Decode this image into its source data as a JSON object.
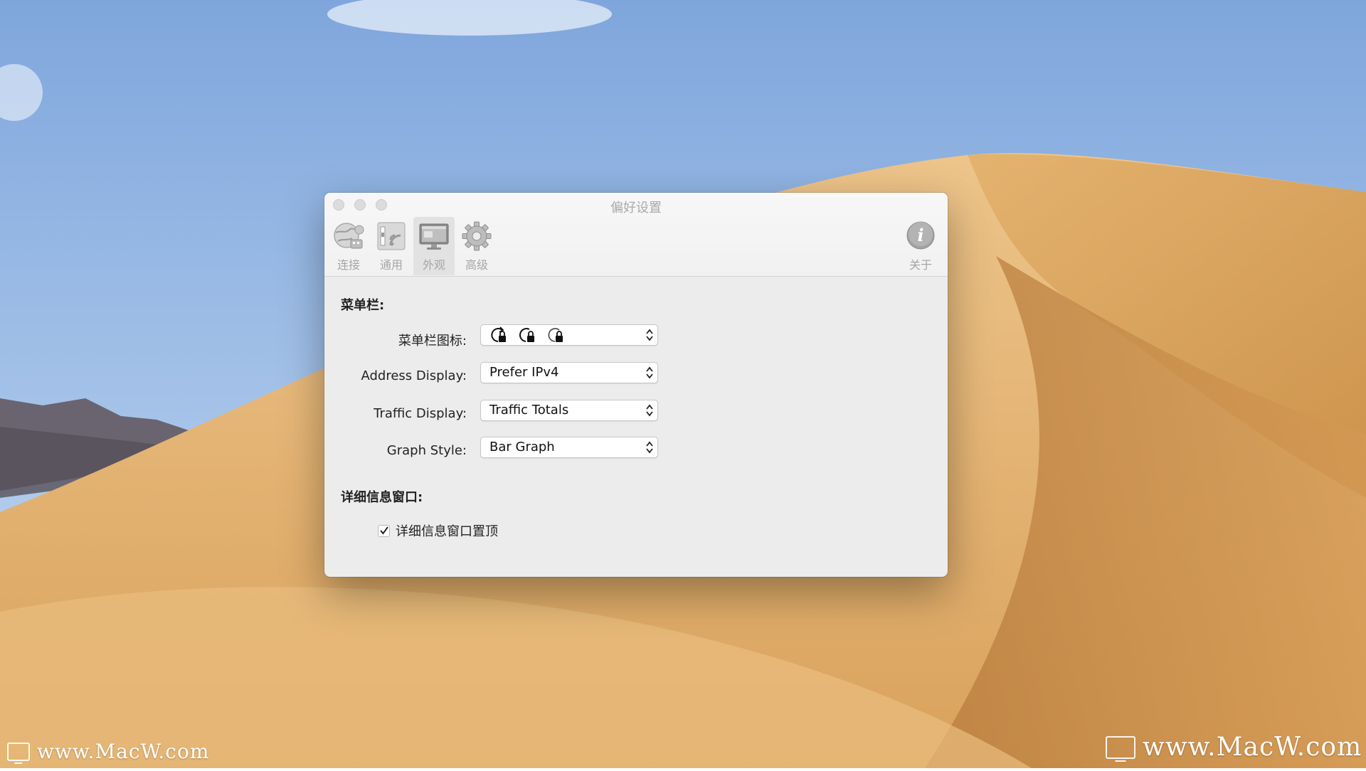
{
  "window": {
    "title": "偏好设置"
  },
  "toolbar": {
    "items": [
      {
        "label": "连接",
        "icon": "globe-network-icon"
      },
      {
        "label": "通用",
        "icon": "general-settings-icon"
      },
      {
        "label": "外观",
        "icon": "display-monitor-icon",
        "selected": true
      },
      {
        "label": "高级",
        "icon": "gear-icon"
      },
      {
        "label": "关于",
        "icon": "info-icon"
      }
    ]
  },
  "menubar_section": {
    "heading": "菜单栏:",
    "icon_label": "菜单栏图标:",
    "icon_value": [
      "lock-refresh-icon",
      "lock-refresh-icon",
      "lock-refresh-icon"
    ],
    "address_label": "Address Display:",
    "address_value": "Prefer IPv4",
    "traffic_label": "Traffic Display:",
    "traffic_value": "Traffic Totals",
    "graph_label": "Graph Style:",
    "graph_value": "Bar Graph"
  },
  "detail_section": {
    "heading": "详细信息窗口:",
    "checkbox_label": "详细信息窗口置顶",
    "checkbox_checked": true
  },
  "watermark": {
    "text": "www.MacW.com"
  },
  "colors": {
    "window_bg": "#ececec",
    "titlebar_bg": "#f4f4f4",
    "label_gray": "#a6a6a6",
    "sky": "#8fb4e6",
    "sand": "#d9a35c"
  }
}
